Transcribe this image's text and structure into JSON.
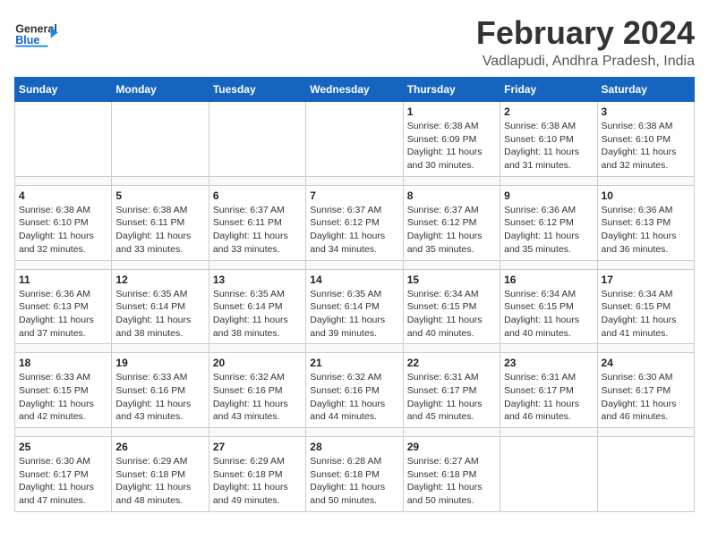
{
  "header": {
    "logo_line1": "General",
    "logo_line2": "Blue",
    "title": "February 2024",
    "subtitle": "Vadlapudi, Andhra Pradesh, India"
  },
  "calendar": {
    "days_of_week": [
      "Sunday",
      "Monday",
      "Tuesday",
      "Wednesday",
      "Thursday",
      "Friday",
      "Saturday"
    ],
    "weeks": [
      [
        {
          "num": "",
          "info": ""
        },
        {
          "num": "",
          "info": ""
        },
        {
          "num": "",
          "info": ""
        },
        {
          "num": "",
          "info": ""
        },
        {
          "num": "1",
          "info": "Sunrise: 6:38 AM\nSunset: 6:09 PM\nDaylight: 11 hours\nand 30 minutes."
        },
        {
          "num": "2",
          "info": "Sunrise: 6:38 AM\nSunset: 6:10 PM\nDaylight: 11 hours\nand 31 minutes."
        },
        {
          "num": "3",
          "info": "Sunrise: 6:38 AM\nSunset: 6:10 PM\nDaylight: 11 hours\nand 32 minutes."
        }
      ],
      [
        {
          "num": "4",
          "info": "Sunrise: 6:38 AM\nSunset: 6:10 PM\nDaylight: 11 hours\nand 32 minutes."
        },
        {
          "num": "5",
          "info": "Sunrise: 6:38 AM\nSunset: 6:11 PM\nDaylight: 11 hours\nand 33 minutes."
        },
        {
          "num": "6",
          "info": "Sunrise: 6:37 AM\nSunset: 6:11 PM\nDaylight: 11 hours\nand 33 minutes."
        },
        {
          "num": "7",
          "info": "Sunrise: 6:37 AM\nSunset: 6:12 PM\nDaylight: 11 hours\nand 34 minutes."
        },
        {
          "num": "8",
          "info": "Sunrise: 6:37 AM\nSunset: 6:12 PM\nDaylight: 11 hours\nand 35 minutes."
        },
        {
          "num": "9",
          "info": "Sunrise: 6:36 AM\nSunset: 6:12 PM\nDaylight: 11 hours\nand 35 minutes."
        },
        {
          "num": "10",
          "info": "Sunrise: 6:36 AM\nSunset: 6:13 PM\nDaylight: 11 hours\nand 36 minutes."
        }
      ],
      [
        {
          "num": "11",
          "info": "Sunrise: 6:36 AM\nSunset: 6:13 PM\nDaylight: 11 hours\nand 37 minutes."
        },
        {
          "num": "12",
          "info": "Sunrise: 6:35 AM\nSunset: 6:14 PM\nDaylight: 11 hours\nand 38 minutes."
        },
        {
          "num": "13",
          "info": "Sunrise: 6:35 AM\nSunset: 6:14 PM\nDaylight: 11 hours\nand 38 minutes."
        },
        {
          "num": "14",
          "info": "Sunrise: 6:35 AM\nSunset: 6:14 PM\nDaylight: 11 hours\nand 39 minutes."
        },
        {
          "num": "15",
          "info": "Sunrise: 6:34 AM\nSunset: 6:15 PM\nDaylight: 11 hours\nand 40 minutes."
        },
        {
          "num": "16",
          "info": "Sunrise: 6:34 AM\nSunset: 6:15 PM\nDaylight: 11 hours\nand 40 minutes."
        },
        {
          "num": "17",
          "info": "Sunrise: 6:34 AM\nSunset: 6:15 PM\nDaylight: 11 hours\nand 41 minutes."
        }
      ],
      [
        {
          "num": "18",
          "info": "Sunrise: 6:33 AM\nSunset: 6:15 PM\nDaylight: 11 hours\nand 42 minutes."
        },
        {
          "num": "19",
          "info": "Sunrise: 6:33 AM\nSunset: 6:16 PM\nDaylight: 11 hours\nand 43 minutes."
        },
        {
          "num": "20",
          "info": "Sunrise: 6:32 AM\nSunset: 6:16 PM\nDaylight: 11 hours\nand 43 minutes."
        },
        {
          "num": "21",
          "info": "Sunrise: 6:32 AM\nSunset: 6:16 PM\nDaylight: 11 hours\nand 44 minutes."
        },
        {
          "num": "22",
          "info": "Sunrise: 6:31 AM\nSunset: 6:17 PM\nDaylight: 11 hours\nand 45 minutes."
        },
        {
          "num": "23",
          "info": "Sunrise: 6:31 AM\nSunset: 6:17 PM\nDaylight: 11 hours\nand 46 minutes."
        },
        {
          "num": "24",
          "info": "Sunrise: 6:30 AM\nSunset: 6:17 PM\nDaylight: 11 hours\nand 46 minutes."
        }
      ],
      [
        {
          "num": "25",
          "info": "Sunrise: 6:30 AM\nSunset: 6:17 PM\nDaylight: 11 hours\nand 47 minutes."
        },
        {
          "num": "26",
          "info": "Sunrise: 6:29 AM\nSunset: 6:18 PM\nDaylight: 11 hours\nand 48 minutes."
        },
        {
          "num": "27",
          "info": "Sunrise: 6:29 AM\nSunset: 6:18 PM\nDaylight: 11 hours\nand 49 minutes."
        },
        {
          "num": "28",
          "info": "Sunrise: 6:28 AM\nSunset: 6:18 PM\nDaylight: 11 hours\nand 50 minutes."
        },
        {
          "num": "29",
          "info": "Sunrise: 6:27 AM\nSunset: 6:18 PM\nDaylight: 11 hours\nand 50 minutes."
        },
        {
          "num": "",
          "info": ""
        },
        {
          "num": "",
          "info": ""
        }
      ]
    ]
  }
}
